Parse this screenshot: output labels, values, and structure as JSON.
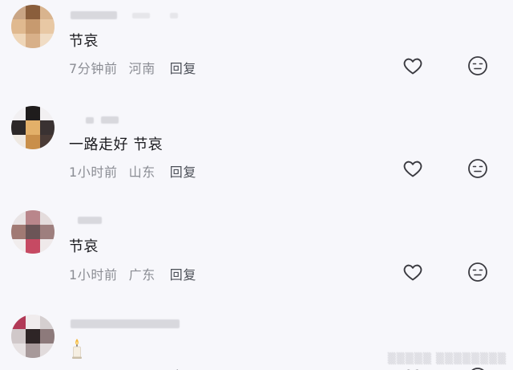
{
  "comments": [
    {
      "text": "节哀",
      "time": "7分钟前",
      "location": "河南",
      "reply_label": "回复"
    },
    {
      "text": "一路走好 节哀",
      "time": "1小时前",
      "location": "山东",
      "reply_label": "回复"
    },
    {
      "text": "节哀",
      "time": "1小时前",
      "location": "广东",
      "reply_label": "回复"
    },
    {
      "text": "",
      "time": "",
      "location": "",
      "reply_label": "回复"
    }
  ],
  "icons": {
    "like": "heart-icon",
    "dislike": "neutral-face-icon",
    "candle": "candle-emoji"
  },
  "colors": {
    "background": "#f7f7fb",
    "text": "#1b1b1f",
    "meta": "#8b8d94",
    "icon": "#3a3a40"
  }
}
